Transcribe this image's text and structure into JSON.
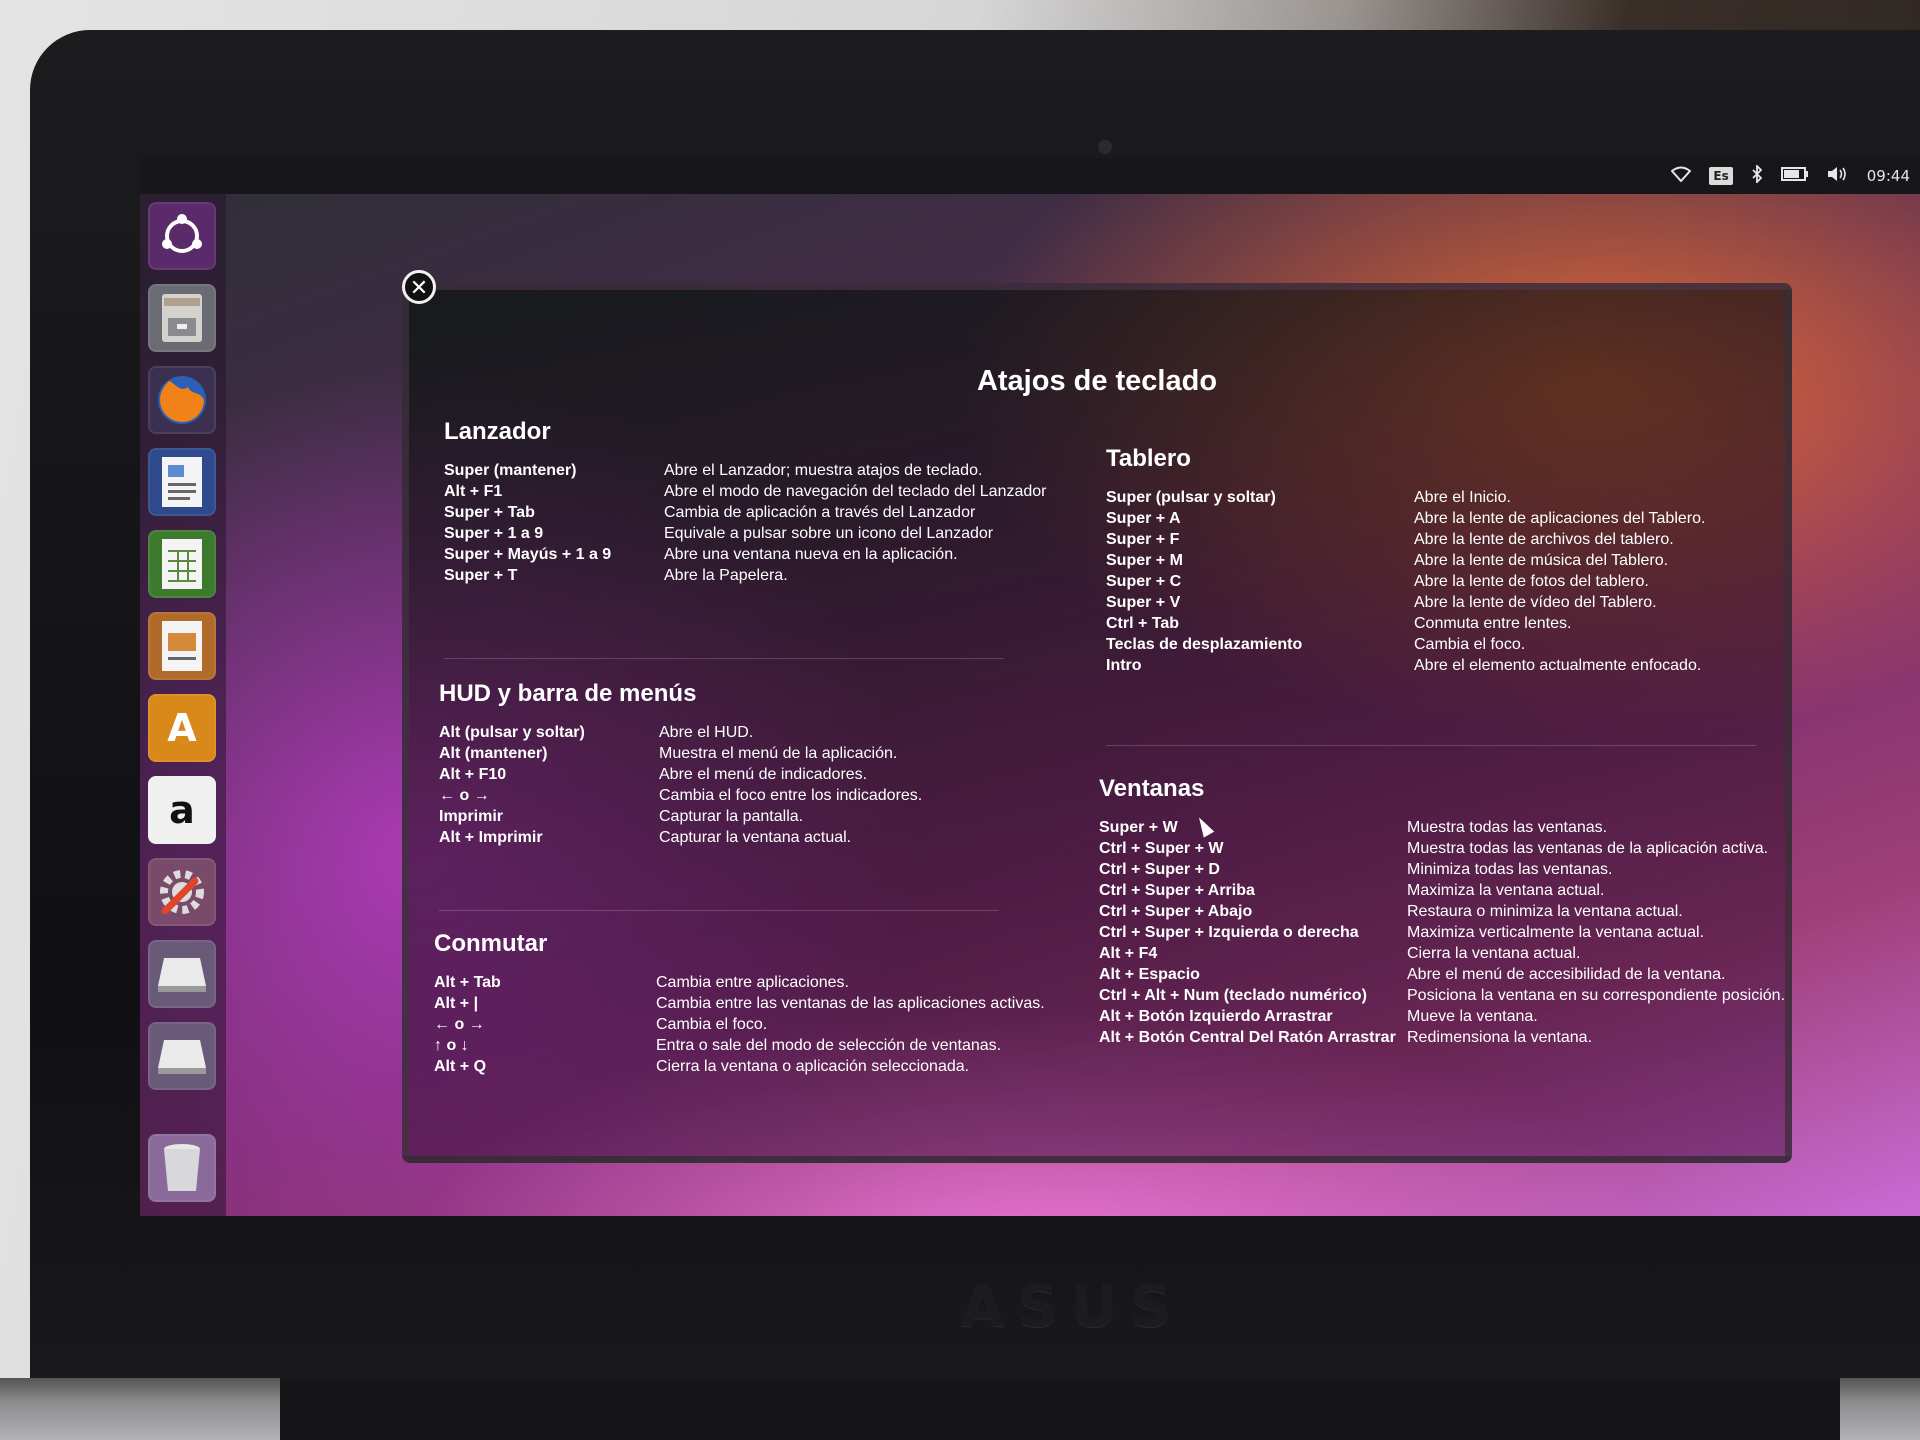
{
  "indicators": {
    "keyboard_layout": "Es",
    "clock": "09:44",
    "network_icon": "wifi-icon",
    "bluetooth_icon": "bluetooth-icon",
    "battery_icon": "battery-icon",
    "volume_icon": "volume-icon"
  },
  "launcher": {
    "items": [
      {
        "name": "Dash",
        "icon": "ubuntu-logo-icon"
      },
      {
        "name": "Files",
        "icon": "file-cabinet-icon"
      },
      {
        "name": "Firefox",
        "icon": "firefox-icon"
      },
      {
        "name": "Writer",
        "icon": "document-icon"
      },
      {
        "name": "Calc",
        "icon": "spreadsheet-icon"
      },
      {
        "name": "Impress",
        "icon": "presentation-icon"
      },
      {
        "name": "Software Center",
        "icon": "shopping-bag-icon",
        "glyph": "A"
      },
      {
        "name": "Amazon",
        "icon": "amazon-icon",
        "glyph": "a"
      },
      {
        "name": "System Settings",
        "icon": "settings-icon"
      },
      {
        "name": "Drive 1",
        "icon": "drive-icon"
      },
      {
        "name": "Drive 2",
        "icon": "drive-icon"
      },
      {
        "name": "Trash",
        "icon": "trash-icon"
      }
    ]
  },
  "shortcuts": {
    "title": "Atajos de teclado",
    "sections": [
      {
        "id": "lanzador",
        "title": "Lanzador",
        "rows": [
          {
            "key": "Super (mantener)",
            "desc": "Abre el Lanzador; muestra atajos de teclado."
          },
          {
            "key": "Alt + F1",
            "desc": "Abre el modo de navegación del teclado del Lanzador"
          },
          {
            "key": "Super + Tab",
            "desc": "Cambia de aplicación a través del Lanzador"
          },
          {
            "key": "Super + 1 a 9",
            "desc": "Equivale a pulsar sobre un icono del Lanzador"
          },
          {
            "key": "Super + Mayús + 1 a 9",
            "desc": "Abre una ventana nueva en la aplicación."
          },
          {
            "key": "Super + T",
            "desc": "Abre la Papelera."
          }
        ]
      },
      {
        "id": "hud",
        "title": "HUD y barra de menús",
        "rows": [
          {
            "key": "Alt (pulsar y soltar)",
            "desc": "Abre el HUD."
          },
          {
            "key": "Alt (mantener)",
            "desc": "Muestra el menú de la aplicación."
          },
          {
            "key": "Alt + F10",
            "desc": "Abre el menú de indicadores."
          },
          {
            "key": "← o →",
            "desc": "Cambia el foco entre los indicadores."
          },
          {
            "key": "Imprimir",
            "desc": "Capturar la pantalla."
          },
          {
            "key": "Alt + Imprimir",
            "desc": "Capturar la ventana actual."
          }
        ]
      },
      {
        "id": "conmutar",
        "title": "Conmutar",
        "rows": [
          {
            "key": "Alt + Tab",
            "desc": "Cambia entre aplicaciones."
          },
          {
            "key": "Alt + |",
            "desc": "Cambia entre las ventanas de las aplicaciones activas."
          },
          {
            "key": "← o →",
            "desc": "Cambia el foco."
          },
          {
            "key": "↑ o ↓",
            "desc": "Entra o sale del modo de selección de ventanas."
          },
          {
            "key": "Alt + Q",
            "desc": "Cierra la ventana o aplicación seleccionada."
          }
        ]
      },
      {
        "id": "tablero",
        "title": "Tablero",
        "rows": [
          {
            "key": "Super (pulsar y soltar)",
            "desc": "Abre el Inicio."
          },
          {
            "key": "Super + A",
            "desc": "Abre la lente de aplicaciones del Tablero."
          },
          {
            "key": "Super + F",
            "desc": "Abre la lente de archivos del tablero."
          },
          {
            "key": "Super + M",
            "desc": "Abre la lente de música del Tablero."
          },
          {
            "key": "Super + C",
            "desc": "Abre la lente de fotos del tablero."
          },
          {
            "key": "Super + V",
            "desc": "Abre la lente de vídeo del Tablero."
          },
          {
            "key": "Ctrl + Tab",
            "desc": "Conmuta entre lentes."
          },
          {
            "key": "Teclas de desplazamiento",
            "desc": "Cambia el foco."
          },
          {
            "key": "Intro",
            "desc": "Abre el elemento actualmente enfocado."
          }
        ]
      },
      {
        "id": "ventanas",
        "title": "Ventanas",
        "rows": [
          {
            "key": "Super + W",
            "desc": "Muestra todas las ventanas."
          },
          {
            "key": "Ctrl + Super + W",
            "desc": "Muestra todas las ventanas de la aplicación activa."
          },
          {
            "key": "Ctrl + Super + D",
            "desc": "Minimiza todas las ventanas."
          },
          {
            "key": "Ctrl + Super + Arriba",
            "desc": "Maximiza la ventana actual."
          },
          {
            "key": "Ctrl + Super + Abajo",
            "desc": "Restaura o minimiza la ventana actual."
          },
          {
            "key": "Ctrl + Super + Izquierda o derecha",
            "desc": "Maximiza verticalmente la ventana actual."
          },
          {
            "key": "Alt + F4",
            "desc": "Cierra la ventana actual."
          },
          {
            "key": "Alt + Espacio",
            "desc": "Abre el menú de accesibilidad de la ventana."
          },
          {
            "key": "Ctrl + Alt + Num (teclado numérico)",
            "desc": "Posiciona la ventana en su correspondiente posición."
          },
          {
            "key": "Alt + Botón Izquierdo Arrastrar",
            "desc": "Mueve la ventana."
          },
          {
            "key": "Alt + Botón Central Del Ratón Arrastrar",
            "desc": "Redimensiona la ventana."
          }
        ]
      }
    ]
  },
  "hardware": {
    "brand_logo": "ASUS"
  }
}
